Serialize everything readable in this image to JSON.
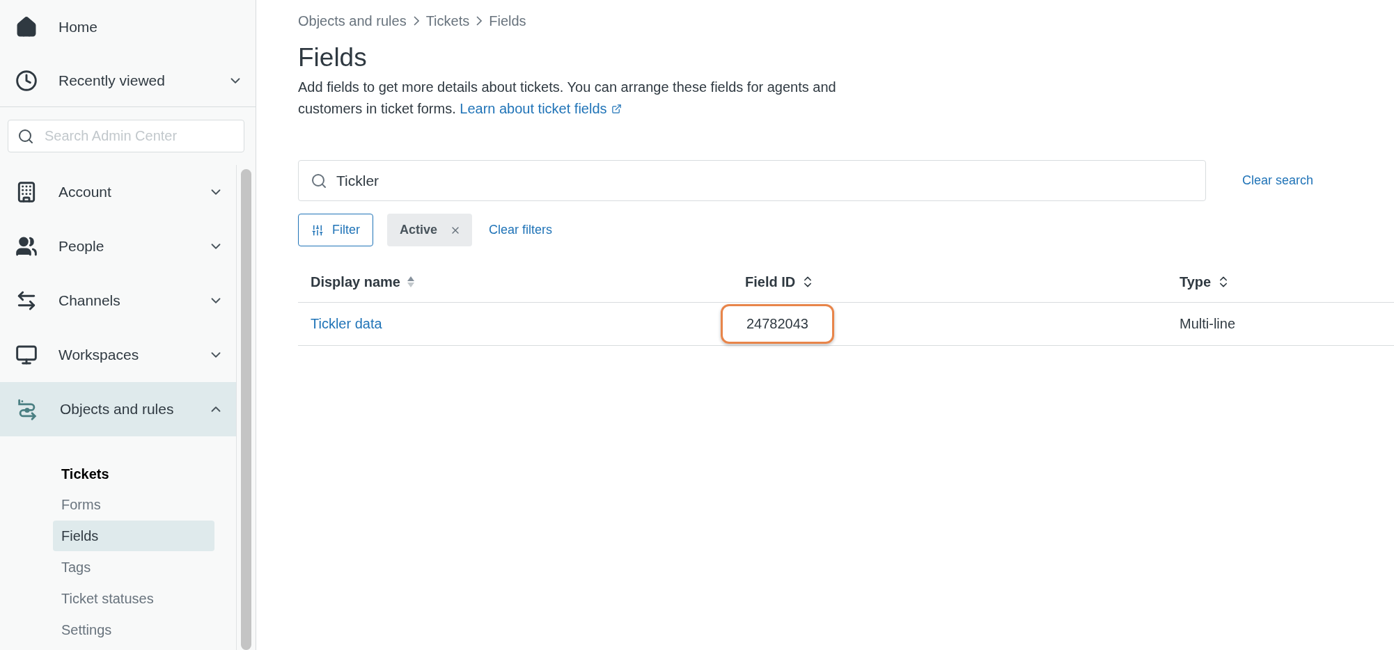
{
  "sidebar": {
    "top_items": [
      {
        "label": "Home"
      },
      {
        "label": "Recently viewed",
        "expanded": false
      }
    ],
    "search": {
      "placeholder": "Search Admin Center"
    },
    "items": [
      {
        "label": "Account",
        "expanded": false,
        "selected": false
      },
      {
        "label": "People",
        "expanded": false,
        "selected": false
      },
      {
        "label": "Channels",
        "expanded": false,
        "selected": false
      },
      {
        "label": "Workspaces",
        "expanded": false,
        "selected": false
      },
      {
        "label": "Objects and rules",
        "expanded": true,
        "selected": true,
        "children": [
          {
            "kind": "heading",
            "label": "Tickets"
          },
          {
            "kind": "link",
            "label": "Forms",
            "selected": false
          },
          {
            "kind": "link",
            "label": "Fields",
            "selected": true
          },
          {
            "kind": "link",
            "label": "Tags",
            "selected": false
          },
          {
            "kind": "link",
            "label": "Ticket statuses",
            "selected": false
          },
          {
            "kind": "link",
            "label": "Settings",
            "selected": false
          }
        ]
      }
    ]
  },
  "breadcrumb": [
    "Objects and rules",
    "Tickets",
    "Fields"
  ],
  "title": "Fields",
  "description": {
    "text": "Add fields to get more details about tickets. You can arrange these fields for agents and customers in ticket forms.",
    "link": "Learn about ticket fields"
  },
  "search": {
    "value": "Tickler",
    "clear_label": "Clear search"
  },
  "filter_button": "Filter",
  "filter_chips": [
    {
      "label": "Active"
    }
  ],
  "clear_filters": "Clear filters",
  "table": {
    "columns": [
      {
        "label": "Display name",
        "sorted": true
      },
      {
        "label": "Field ID",
        "sorted": false
      },
      {
        "label": "Type",
        "sorted": false
      }
    ],
    "rows": [
      {
        "display_name": "Tickler data",
        "field_id": "24782043",
        "type": "Multi-line",
        "highlighted": true
      }
    ]
  }
}
